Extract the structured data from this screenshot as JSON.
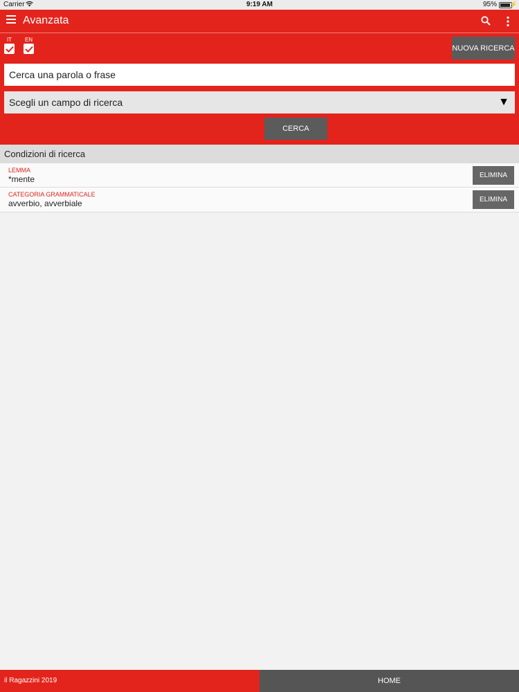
{
  "status_bar": {
    "carrier": "Carrier",
    "time": "9:19 AM",
    "battery": "95%"
  },
  "app_bar": {
    "title": "Avanzata",
    "icons": [
      "menu-icon",
      "search-icon",
      "more-vert-icon"
    ]
  },
  "languages": [
    {
      "code": "IT",
      "checked": true
    },
    {
      "code": "EN",
      "checked": true
    }
  ],
  "new_search_label": "NUOVA RICERCA",
  "search": {
    "query_label": "Cerca una parola o frase",
    "field_select_label": "Scegli un campo di ricerca",
    "submit_label": "CERCA"
  },
  "conditions": {
    "header": "Condizioni di ricerca",
    "items": [
      {
        "label": "LEMMA",
        "value": "*mente",
        "action": "ELIMINA"
      },
      {
        "label": "CATEGORIA GRAMMATICALE",
        "value": "avverbio, avverbiale",
        "action": "ELIMINA"
      }
    ]
  },
  "footer": {
    "copyright": "il Ragazzini 2019",
    "home_label": "HOME"
  },
  "colors": {
    "accent": "#e3241c",
    "button_dark": "#5b5b5b"
  }
}
